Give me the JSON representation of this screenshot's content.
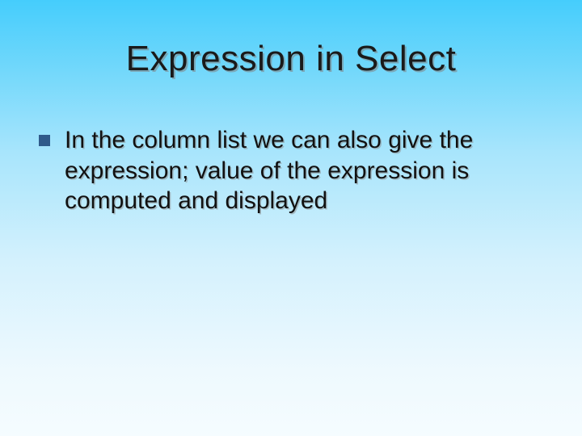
{
  "slide": {
    "title": "Expression in Select",
    "bullets": [
      {
        "text": "In the column list we can also give the expression; value of the expression is computed and displayed"
      }
    ]
  }
}
